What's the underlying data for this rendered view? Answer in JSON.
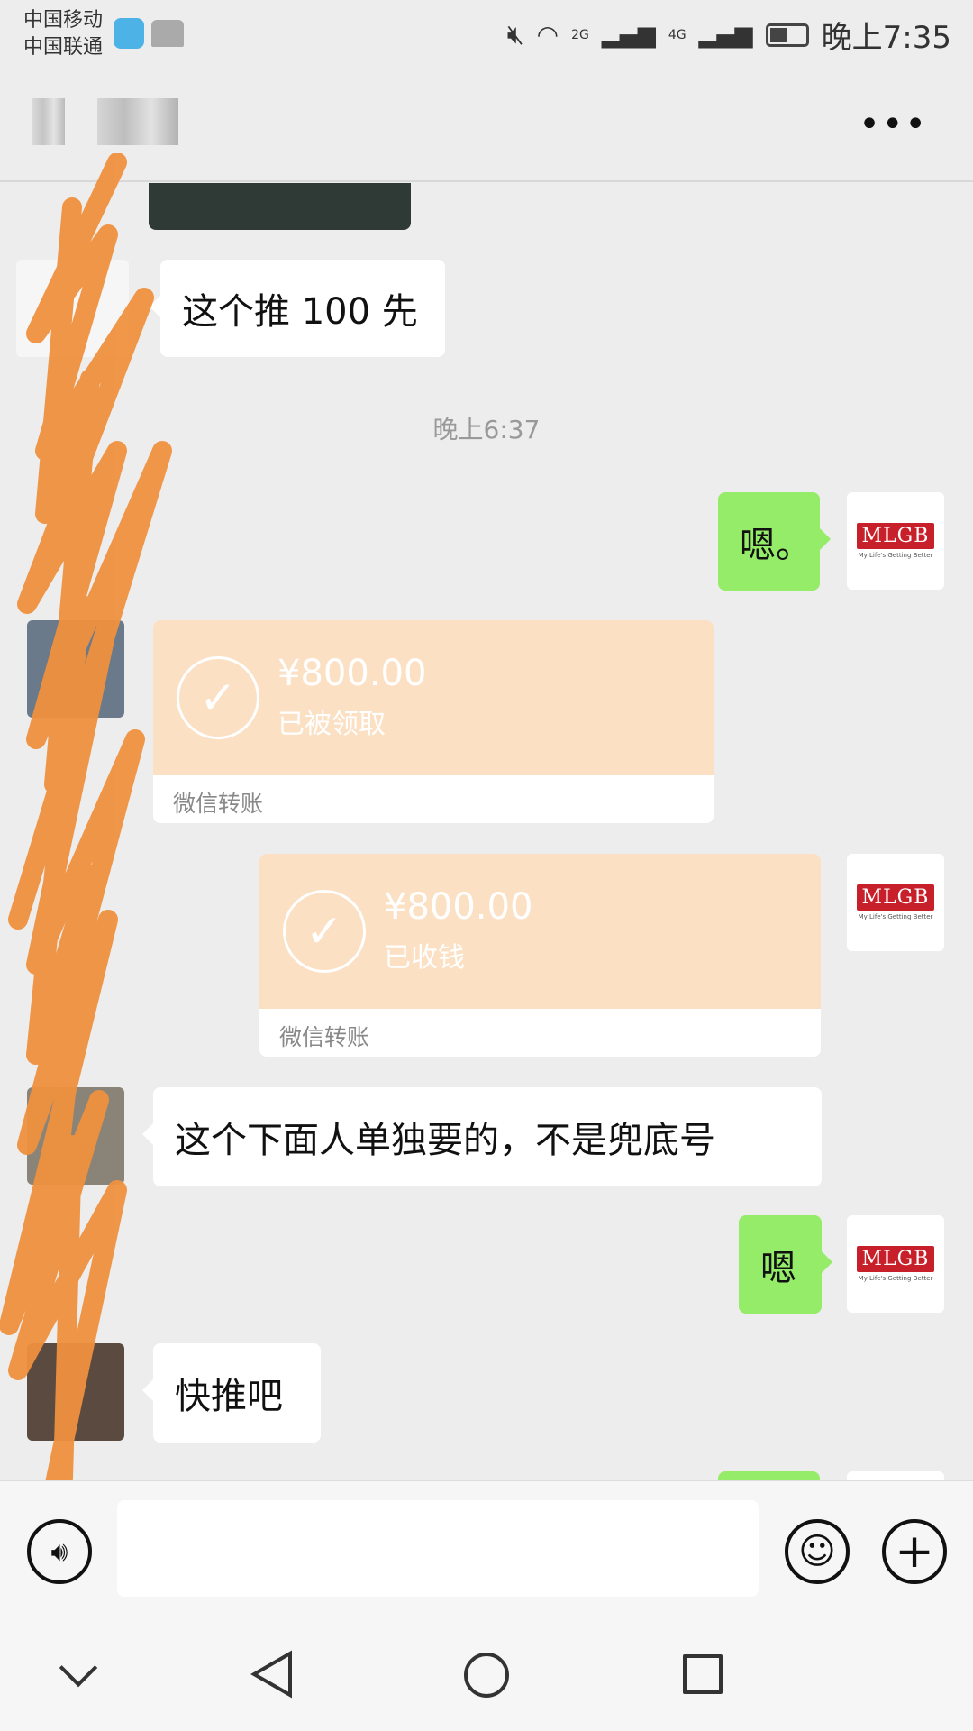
{
  "status_bar": {
    "carrier1": "中国移动",
    "carrier2": "中国联通",
    "net1": "2G",
    "net2": "4G",
    "time": "晚上7:35"
  },
  "header": {
    "more_label": "•••"
  },
  "messages": [
    {
      "side": "left",
      "text": "这个推 100 先"
    },
    {
      "timestamp": "晚上6:37"
    },
    {
      "side": "right",
      "text": "嗯。"
    },
    {
      "side": "left",
      "type": "transfer",
      "amount": "¥800.00",
      "status": "已被领取",
      "footer": "微信转账"
    },
    {
      "side": "right",
      "type": "transfer",
      "amount": "¥800.00",
      "status": "已收钱",
      "footer": "微信转账"
    },
    {
      "side": "left",
      "text": "这个下面人单独要的，不是兜底号"
    },
    {
      "side": "right",
      "text": "嗯"
    },
    {
      "side": "left",
      "text": "快推吧"
    }
  ],
  "avatar_me": {
    "logo": "MLGB",
    "tagline": "My Life's Getting Better"
  },
  "colors": {
    "bg": "#ededed",
    "my_bubble": "#95ec69",
    "transfer": "#fbe0c4",
    "scribble": "#f0913f"
  }
}
